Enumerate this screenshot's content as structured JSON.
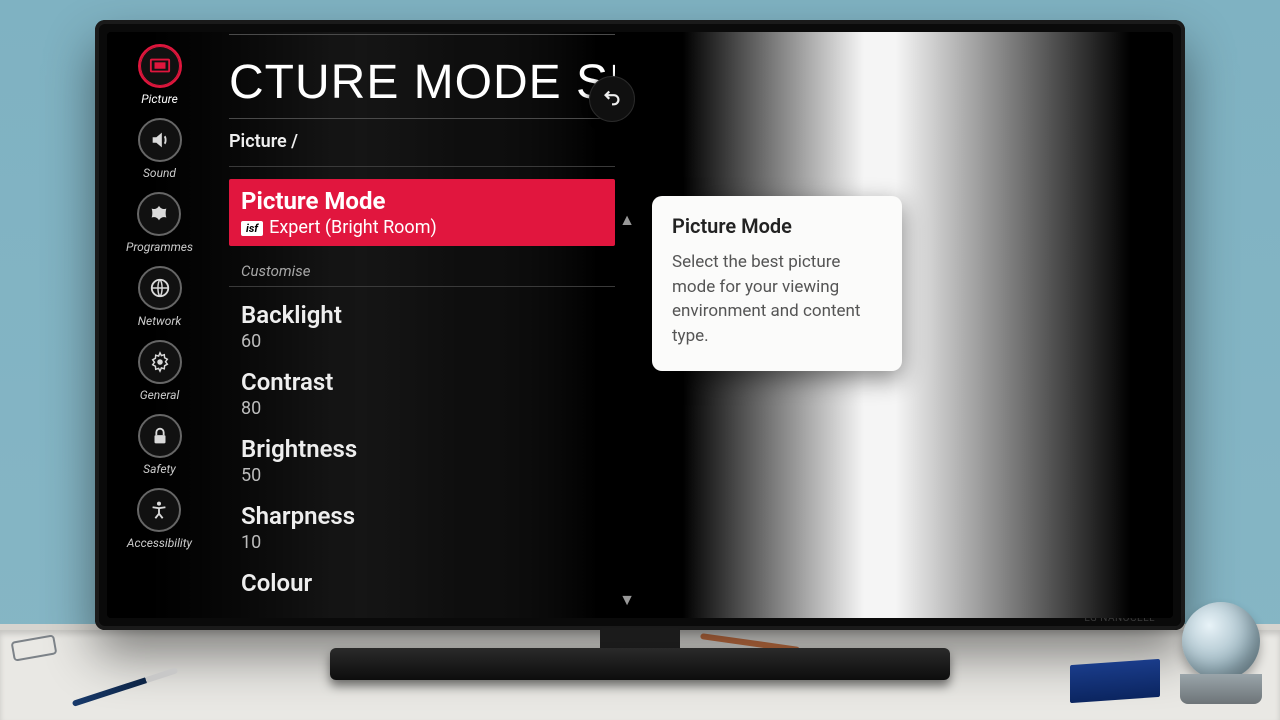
{
  "sidebar": {
    "items": [
      {
        "label": "Picture",
        "icon": "picture"
      },
      {
        "label": "Sound",
        "icon": "sound"
      },
      {
        "label": "Programmes",
        "icon": "programmes"
      },
      {
        "label": "Network",
        "icon": "network"
      },
      {
        "label": "General",
        "icon": "general"
      },
      {
        "label": "Safety",
        "icon": "safety"
      },
      {
        "label": "Accessibility",
        "icon": "accessibility"
      }
    ],
    "active_index": 0
  },
  "page": {
    "title": "CTURE MODE SE",
    "breadcrumb": "Picture /"
  },
  "picture_mode": {
    "label": "Picture Mode",
    "badge": "isf",
    "value": "Expert (Bright Room)"
  },
  "customise": {
    "heading": "Customise",
    "items": [
      {
        "label": "Backlight",
        "value": "60"
      },
      {
        "label": "Contrast",
        "value": "80"
      },
      {
        "label": "Brightness",
        "value": "50"
      },
      {
        "label": "Sharpness",
        "value": "10"
      },
      {
        "label": "Colour",
        "value": ""
      }
    ]
  },
  "tooltip": {
    "title": "Picture Mode",
    "body": "Select the best picture mode for your viewing environment and content type."
  },
  "tv_brand": "LG NANOCELL"
}
